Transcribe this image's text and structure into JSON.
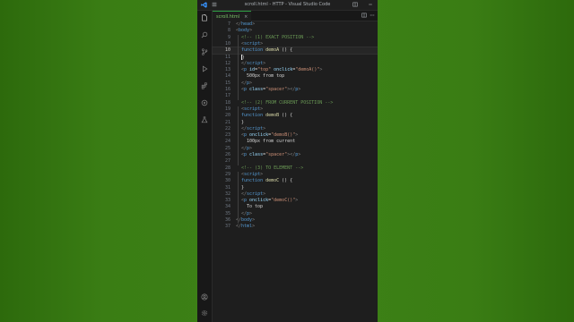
{
  "window": {
    "title": "scroll.html - HTTP - Visual Studio Code"
  },
  "tab": {
    "label": "scroll.html",
    "close": "×"
  },
  "editor": {
    "active_line": 10,
    "lines": [
      {
        "n": "7",
        "segs": [
          {
            "t": "pun",
            "v": "</"
          },
          {
            "t": "tag",
            "v": "head"
          },
          {
            "t": "pun",
            "v": ">"
          }
        ],
        "indent": 0
      },
      {
        "n": "8",
        "segs": [
          {
            "t": "pun",
            "v": "<"
          },
          {
            "t": "tag",
            "v": "body"
          },
          {
            "t": "pun",
            "v": ">"
          }
        ],
        "indent": 0
      },
      {
        "n": "9",
        "segs": [
          {
            "t": "com",
            "v": "<!-- (1) EXACT POSITION -->"
          }
        ],
        "indent": 1
      },
      {
        "n": "10",
        "segs": [
          {
            "t": "pun",
            "v": "<"
          },
          {
            "t": "tag",
            "v": "script"
          },
          {
            "t": "pun",
            "v": ">"
          }
        ],
        "indent": 1
      },
      {
        "n": "10",
        "segs": [
          {
            "t": "kw",
            "v": "function "
          },
          {
            "t": "fn",
            "v": "demoA"
          },
          {
            "t": "txt",
            "v": " () {"
          }
        ],
        "indent": 1
      },
      {
        "n": "11",
        "segs": [
          {
            "t": "txt",
            "v": "}"
          }
        ],
        "indent": 1
      },
      {
        "n": "12",
        "segs": [
          {
            "t": "pun",
            "v": "</"
          },
          {
            "t": "tag",
            "v": "script"
          },
          {
            "t": "pun",
            "v": ">"
          }
        ],
        "indent": 1
      },
      {
        "n": "13",
        "segs": [
          {
            "t": "pun",
            "v": "<"
          },
          {
            "t": "tag",
            "v": "p"
          },
          {
            "t": "attr",
            "v": " id"
          },
          {
            "t": "txt",
            "v": "="
          },
          {
            "t": "str",
            "v": "\"top\""
          },
          {
            "t": "attr",
            "v": " onclick"
          },
          {
            "t": "txt",
            "v": "="
          },
          {
            "t": "str",
            "v": "\"demoA()\""
          },
          {
            "t": "pun",
            "v": ">"
          }
        ],
        "indent": 1
      },
      {
        "n": "14",
        "segs": [
          {
            "t": "txt",
            "v": "500px from top"
          }
        ],
        "indent": 2
      },
      {
        "n": "15",
        "segs": [
          {
            "t": "pun",
            "v": "</"
          },
          {
            "t": "tag",
            "v": "p"
          },
          {
            "t": "pun",
            "v": ">"
          }
        ],
        "indent": 1
      },
      {
        "n": "16",
        "segs": [
          {
            "t": "pun",
            "v": "<"
          },
          {
            "t": "tag",
            "v": "p"
          },
          {
            "t": "attr",
            "v": " class"
          },
          {
            "t": "txt",
            "v": "="
          },
          {
            "t": "str",
            "v": "\"spacer\""
          },
          {
            "t": "pun",
            "v": "></"
          },
          {
            "t": "tag",
            "v": "p"
          },
          {
            "t": "pun",
            "v": ">"
          }
        ],
        "indent": 1
      },
      {
        "n": "17",
        "segs": [],
        "indent": 0
      },
      {
        "n": "18",
        "segs": [
          {
            "t": "com",
            "v": "<!-- (2) FROM CURRENT POSITION -->"
          }
        ],
        "indent": 1
      },
      {
        "n": "19",
        "segs": [
          {
            "t": "pun",
            "v": "<"
          },
          {
            "t": "tag",
            "v": "script"
          },
          {
            "t": "pun",
            "v": ">"
          }
        ],
        "indent": 1
      },
      {
        "n": "20",
        "segs": [
          {
            "t": "kw",
            "v": "function "
          },
          {
            "t": "fn",
            "v": "demoB"
          },
          {
            "t": "txt",
            "v": " () {"
          }
        ],
        "indent": 1
      },
      {
        "n": "21",
        "segs": [
          {
            "t": "txt",
            "v": "}"
          }
        ],
        "indent": 1
      },
      {
        "n": "22",
        "segs": [
          {
            "t": "pun",
            "v": "</"
          },
          {
            "t": "tag",
            "v": "script"
          },
          {
            "t": "pun",
            "v": ">"
          }
        ],
        "indent": 1
      },
      {
        "n": "23",
        "segs": [
          {
            "t": "pun",
            "v": "<"
          },
          {
            "t": "tag",
            "v": "p"
          },
          {
            "t": "attr",
            "v": " onclick"
          },
          {
            "t": "txt",
            "v": "="
          },
          {
            "t": "str",
            "v": "\"demoB()\""
          },
          {
            "t": "pun",
            "v": ">"
          }
        ],
        "indent": 1
      },
      {
        "n": "24",
        "segs": [
          {
            "t": "txt",
            "v": "100px from current"
          }
        ],
        "indent": 2
      },
      {
        "n": "25",
        "segs": [
          {
            "t": "pun",
            "v": "</"
          },
          {
            "t": "tag",
            "v": "p"
          },
          {
            "t": "pun",
            "v": ">"
          }
        ],
        "indent": 1
      },
      {
        "n": "26",
        "segs": [
          {
            "t": "pun",
            "v": "<"
          },
          {
            "t": "tag",
            "v": "p"
          },
          {
            "t": "attr",
            "v": " class"
          },
          {
            "t": "txt",
            "v": "="
          },
          {
            "t": "str",
            "v": "\"spacer\""
          },
          {
            "t": "pun",
            "v": "></"
          },
          {
            "t": "tag",
            "v": "p"
          },
          {
            "t": "pun",
            "v": ">"
          }
        ],
        "indent": 1
      },
      {
        "n": "27",
        "segs": [],
        "indent": 0
      },
      {
        "n": "28",
        "segs": [
          {
            "t": "com",
            "v": "<!-- (3) TO ELEMENT -->"
          }
        ],
        "indent": 1
      },
      {
        "n": "29",
        "segs": [
          {
            "t": "pun",
            "v": "<"
          },
          {
            "t": "tag",
            "v": "script"
          },
          {
            "t": "pun",
            "v": ">"
          }
        ],
        "indent": 1
      },
      {
        "n": "30",
        "segs": [
          {
            "t": "kw",
            "v": "function "
          },
          {
            "t": "fn",
            "v": "demoC"
          },
          {
            "t": "txt",
            "v": " () {"
          }
        ],
        "indent": 1
      },
      {
        "n": "31",
        "segs": [
          {
            "t": "txt",
            "v": "}"
          }
        ],
        "indent": 1
      },
      {
        "n": "32",
        "segs": [
          {
            "t": "pun",
            "v": "</"
          },
          {
            "t": "tag",
            "v": "script"
          },
          {
            "t": "pun",
            "v": ">"
          }
        ],
        "indent": 1
      },
      {
        "n": "33",
        "segs": [
          {
            "t": "pun",
            "v": "<"
          },
          {
            "t": "tag",
            "v": "p"
          },
          {
            "t": "attr",
            "v": " onclick"
          },
          {
            "t": "txt",
            "v": "="
          },
          {
            "t": "str",
            "v": "\"demoC()\""
          },
          {
            "t": "pun",
            "v": ">"
          }
        ],
        "indent": 1
      },
      {
        "n": "34",
        "segs": [
          {
            "t": "txt",
            "v": "To top"
          }
        ],
        "indent": 2
      },
      {
        "n": "35",
        "segs": [
          {
            "t": "pun",
            "v": "</"
          },
          {
            "t": "tag",
            "v": "p"
          },
          {
            "t": "pun",
            "v": ">"
          }
        ],
        "indent": 1
      },
      {
        "n": "36",
        "segs": [
          {
            "t": "pun",
            "v": "</"
          },
          {
            "t": "tag",
            "v": "body"
          },
          {
            "t": "pun",
            "v": ">"
          }
        ],
        "indent": 0
      },
      {
        "n": "37",
        "segs": [
          {
            "t": "pun",
            "v": "</"
          },
          {
            "t": "tag",
            "v": "html"
          },
          {
            "t": "pun",
            "v": ">"
          }
        ],
        "indent": 0
      }
    ]
  },
  "activity_bar": [
    "files-icon",
    "search-icon",
    "source-control-icon",
    "run-debug-icon",
    "extensions-icon",
    "remote-icon",
    "testing-icon"
  ],
  "colors": {
    "background": "#3a7d14",
    "editor": "#1e1e1e",
    "tab_accent": "#2ea043"
  }
}
